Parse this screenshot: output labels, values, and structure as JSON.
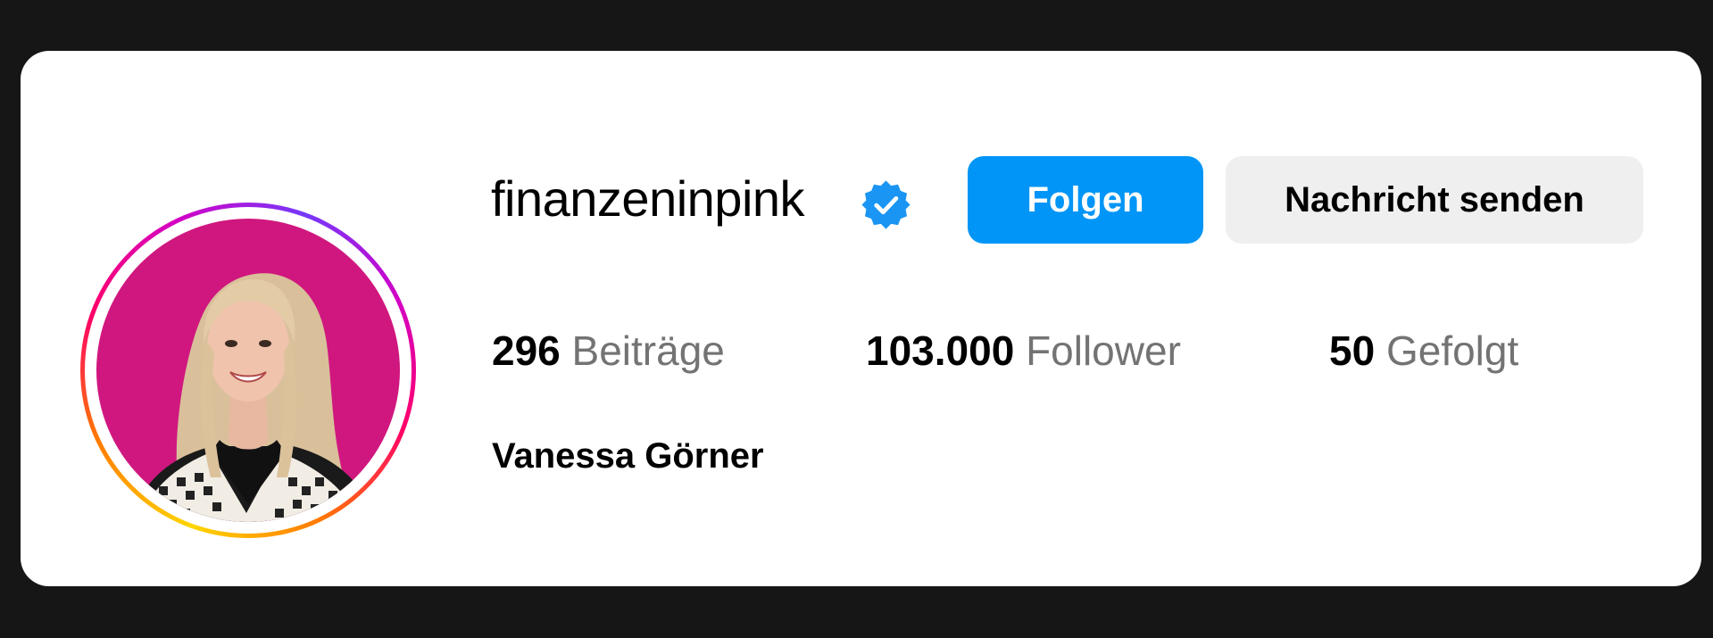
{
  "profile": {
    "username": "finanzeninpink",
    "verified": true,
    "full_name": "Vanessa Görner",
    "avatar_icon": "profile-photo-avatar"
  },
  "actions": {
    "follow_label": "Folgen",
    "message_label": "Nachricht senden"
  },
  "stats": {
    "posts": {
      "count": "296",
      "label": "Beiträge"
    },
    "followers": {
      "count": "103.000",
      "label": "Follower"
    },
    "following": {
      "count": "50",
      "label": "Gefolgt"
    }
  },
  "colors": {
    "page_background": "#161616",
    "card_background": "#ffffff",
    "primary_button": "#0095f6",
    "secondary_button": "#efefef",
    "avatar_background": "#d0177f",
    "verified_badge": "#1a95f3",
    "muted_text": "#737373"
  }
}
